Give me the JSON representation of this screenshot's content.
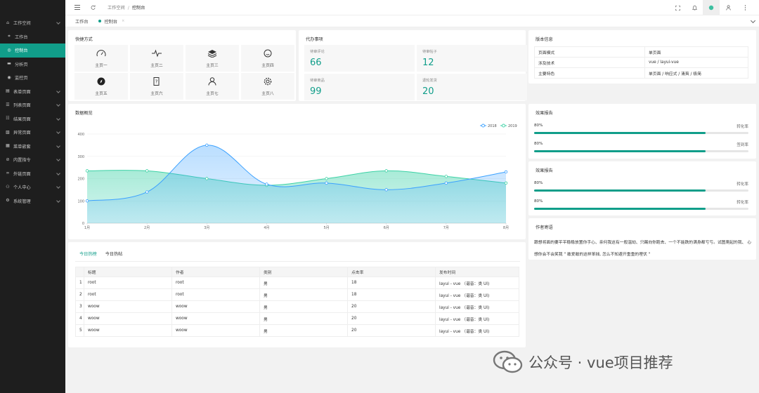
{
  "sidebar": {
    "items": [
      {
        "label": "工作空间",
        "icon": "home-icon",
        "expandable": true,
        "active": false,
        "sub": false
      },
      {
        "label": "工作台",
        "icon": "workbench-icon",
        "expandable": false,
        "active": false,
        "sub": true
      },
      {
        "label": "控制台",
        "icon": "console-icon",
        "expandable": false,
        "active": true,
        "sub": true
      },
      {
        "label": "分析页",
        "icon": "analysis-icon",
        "expandable": false,
        "active": false,
        "sub": true
      },
      {
        "label": "监控页",
        "icon": "monitor-icon",
        "expandable": false,
        "active": false,
        "sub": true
      },
      {
        "label": "表单页面",
        "icon": "form-icon",
        "expandable": true,
        "active": false,
        "sub": false
      },
      {
        "label": "列表页面",
        "icon": "list-icon",
        "expandable": true,
        "active": false,
        "sub": false
      },
      {
        "label": "结果页面",
        "icon": "result-icon",
        "expandable": true,
        "active": false,
        "sub": false
      },
      {
        "label": "异常页面",
        "icon": "error-icon",
        "expandable": true,
        "active": false,
        "sub": false
      },
      {
        "label": "菜单嵌套",
        "icon": "nested-menu-icon",
        "expandable": true,
        "active": false,
        "sub": false
      },
      {
        "label": "内置指令",
        "icon": "directive-icon",
        "expandable": true,
        "active": false,
        "sub": false
      },
      {
        "label": "外链页面",
        "icon": "link-icon",
        "expandable": true,
        "active": false,
        "sub": false
      },
      {
        "label": "个人中心",
        "icon": "user-icon",
        "expandable": true,
        "active": false,
        "sub": false
      },
      {
        "label": "系统管理",
        "icon": "settings-icon",
        "expandable": true,
        "active": false,
        "sub": false
      }
    ]
  },
  "header": {
    "breadcrumb": [
      "工作空间",
      "控制台"
    ],
    "breadcrumb_sep": "/",
    "icons_left": [
      "menu-fold-icon",
      "refresh-icon"
    ],
    "icons_right": [
      "fullscreen-icon",
      "bell-icon",
      "theme-icon",
      "avatar-icon",
      "more-icon"
    ]
  },
  "tabs": [
    {
      "label": "工作台",
      "active": false
    },
    {
      "label": "控制台",
      "active": true,
      "close": "×"
    }
  ],
  "shortcuts": {
    "title": "快捷方式",
    "items": [
      {
        "label": "主页一",
        "icon": "gauge-icon"
      },
      {
        "label": "主页二",
        "icon": "pulse-icon"
      },
      {
        "label": "主页三",
        "icon": "layers-icon"
      },
      {
        "label": "主页四",
        "icon": "smile-icon"
      },
      {
        "label": "主页五",
        "icon": "compass-icon"
      },
      {
        "label": "主页六",
        "icon": "help-doc-icon"
      },
      {
        "label": "主页七",
        "icon": "user-outline-icon"
      },
      {
        "label": "主页八",
        "icon": "gear-icon"
      }
    ]
  },
  "todo": {
    "title": "代办事项",
    "items": [
      {
        "label": "待审评论",
        "value": "66"
      },
      {
        "label": "待审帖子",
        "value": "12"
      },
      {
        "label": "待审商品",
        "value": "99"
      },
      {
        "label": "退轮发货",
        "value": "20"
      }
    ]
  },
  "version": {
    "title": "版本信息",
    "rows": [
      {
        "key": "页面模式",
        "value": "单页面"
      },
      {
        "key": "涉及技术",
        "value": "vue / layui-vue"
      },
      {
        "key": "主要特色",
        "value": "单页面 / 响应式 / 清爽 / 极简"
      }
    ]
  },
  "overview": {
    "title": "数据概览"
  },
  "chart_data": {
    "type": "area",
    "title": "数据概览",
    "categories": [
      "1月",
      "2月",
      "3月",
      "4月",
      "5月",
      "6月",
      "7月",
      "8月"
    ],
    "series": [
      {
        "name": "2018",
        "values": [
          100,
          140,
          350,
          175,
          180,
          150,
          180,
          230
        ],
        "color": "#3ba1ff"
      },
      {
        "name": "2019",
        "values": [
          235,
          235,
          200,
          170,
          200,
          235,
          210,
          180
        ],
        "color": "#3dd2a6"
      }
    ],
    "yticks": [
      "0",
      "100",
      "200",
      "300",
      "400"
    ],
    "ylim": [
      0,
      400
    ],
    "legend": "top-right",
    "grid": true
  },
  "effect1": {
    "title": "效果报告",
    "rows": [
      {
        "percent_label": "80%",
        "right": "转化率",
        "value": 0.8
      },
      {
        "percent_label": "80%",
        "right": "签到率",
        "value": 0.8
      }
    ]
  },
  "effect2": {
    "title": "效果报告",
    "rows": [
      {
        "percent_label": "80%",
        "right": "转化率",
        "value": 0.8
      },
      {
        "percent_label": "80%",
        "right": "转化率",
        "value": 0.8
      }
    ]
  },
  "author": {
    "title": "作者寄语",
    "text": "跟想将面的要平平稳稳放置你手心、亲何我这有一般温劫、只踢向你跑去、一个不能跌的满身都亏亏。试图爬起的我、 心想你会不会笑我 \" 敢爱敢的这样笨拙, 怎么不知避开重重的埋伏 \""
  },
  "hot": {
    "tabs": [
      {
        "label": "今日热榜",
        "active": true
      },
      {
        "label": "今日热帖",
        "active": false
      }
    ],
    "columns": [
      "",
      "标题",
      "作者",
      "类别",
      "点击率",
      "发布时间"
    ],
    "rows": [
      [
        "1",
        "root",
        "root",
        "男",
        "18",
        "layui - vue （谐音：类 UI)"
      ],
      [
        "2",
        "root",
        "root",
        "男",
        "18",
        "layui - vue （谐音：类 UI)"
      ],
      [
        "3",
        "woow",
        "woow",
        "男",
        "20",
        "layui - vue （谐音：类 UI)"
      ],
      [
        "4",
        "woow",
        "woow",
        "男",
        "20",
        "layui - vue （谐音：类 UI)"
      ],
      [
        "5",
        "woow",
        "woow",
        "男",
        "20",
        "layui - vue （谐音：类 UI)"
      ]
    ]
  },
  "watermark": {
    "text": "公众号 · vue项目推荐",
    "icon": "wechat-icon"
  },
  "colors": {
    "accent": "#119e8a",
    "sidebar_bg": "#1e1e1e",
    "series_2018": "#3ba1ff",
    "series_2019": "#3dd2a6"
  }
}
